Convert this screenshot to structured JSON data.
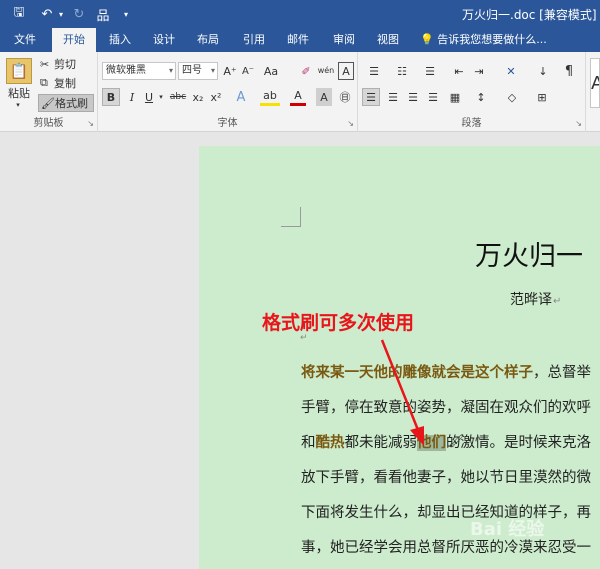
{
  "title": {
    "doc_title": "万火归一.doc [兼容模式] - We",
    "quick_access": {
      "save": "🖫",
      "undo": "↶",
      "undo_arrow": "▾",
      "redo": "↻",
      "tree": "品",
      "more": "▾"
    }
  },
  "tabs": [
    {
      "label": "文件"
    },
    {
      "label": "开始"
    },
    {
      "label": "插入"
    },
    {
      "label": "设计"
    },
    {
      "label": "布局"
    },
    {
      "label": "引用"
    },
    {
      "label": "邮件"
    },
    {
      "label": "审阅"
    },
    {
      "label": "视图"
    }
  ],
  "tellme": {
    "icon": "💡",
    "text": "告诉我您想要做什么..."
  },
  "clipboard": {
    "paste": "粘贴",
    "paste_arrow": "▾",
    "cut": "剪切",
    "copy": "复制",
    "format_painter": "格式刷",
    "group_label": "剪贴板",
    "launcher": "↘"
  },
  "font": {
    "font_name": "微软雅黑",
    "font_size": "四号",
    "grow": "A⁺",
    "shrink": "A⁻",
    "change_case": "Aa",
    "clear": "✐",
    "phonetic": "wén",
    "border": "A",
    "bold": "B",
    "italic": "I",
    "underline": "U",
    "underline_arrow": "▾",
    "strike": "abc",
    "subscript": "x₂",
    "superscript": "x²",
    "effects": "A",
    "highlight": "ab",
    "font_color": "A",
    "shade": "A",
    "enclose": "㊐",
    "group_label": "字体",
    "launcher": "↘"
  },
  "paragraph": {
    "bullets": "☰",
    "numbering": "☷",
    "multilevel": "☰",
    "decrease_indent": "⇤",
    "increase_indent": "⇥",
    "asian_layout": "✕",
    "sort": "↓",
    "show_marks": "¶",
    "align_left": "☰",
    "align_center": "☰",
    "align_right": "☰",
    "justify": "☰",
    "distributed": "▦",
    "line_spacing": "↕",
    "shading": "◇",
    "borders": "⊞",
    "group_label": "段落",
    "launcher": "↘"
  },
  "styles_preview": "A",
  "document": {
    "heading": "万火归一",
    "heading_mark": "↵",
    "author": "范晔译",
    "author_mark": "↵",
    "para_mark": "↵",
    "annotation": "格式刷可多次使用",
    "line1": {
      "hl": "将来某一天他的雕像就会是这个样子",
      "rest": "，总督举"
    },
    "line2": "手臂，停在致意的姿势，凝固在观众们的欢呼",
    "line3": {
      "pre": "和",
      "hl": "酷热",
      "mid": "都未能减弱",
      "sel": "他们",
      "rest": "的激情。是时候来克洛"
    },
    "line4": "放下手臂，看看他妻子，她以节日里漠然的微",
    "line5": "下面将发生什么，却显出已经知道的样子，再",
    "line6": "事，她已经学会用总督所厌恶的冷漠来忍受一"
  },
  "watermark": "Bai 经验",
  "colors": {
    "accent": "#2b579a",
    "page": "#cdeccd",
    "annotation": "#e8151b",
    "highlight_text": "#7a5a12"
  }
}
